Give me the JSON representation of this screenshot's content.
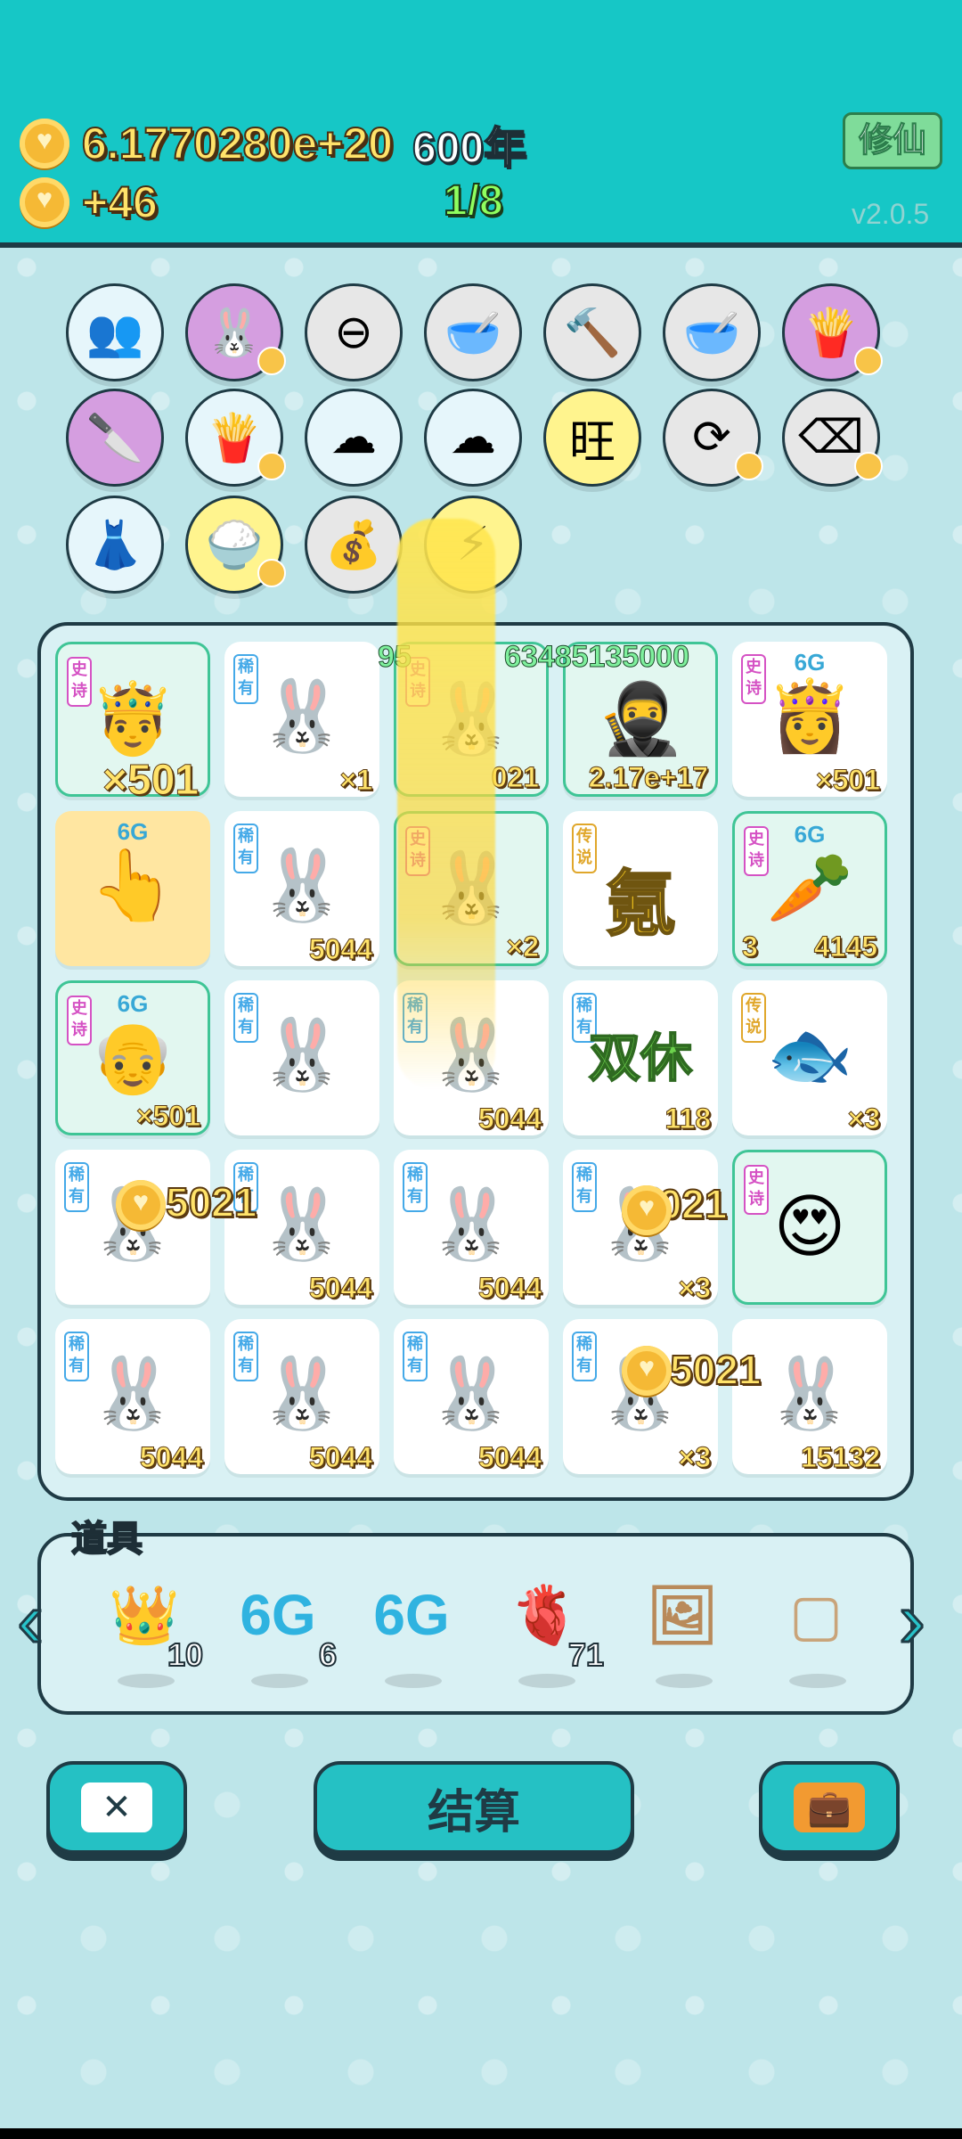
{
  "header": {
    "coins_total": "6.1770280e+20",
    "years": "600年",
    "coins_rate": "+46",
    "level": "1/8",
    "cultivate_label": "修仙",
    "version": "v2.0.5"
  },
  "shelf": {
    "items": [
      {
        "name": "twins-icon",
        "glyph": "👥",
        "bg": "#e6f6fb"
      },
      {
        "name": "rabbit-icon",
        "glyph": "🐰",
        "bg": "#d59ee0"
      },
      {
        "name": "ban-icon",
        "glyph": "⊖",
        "bg": "#e7e7e7"
      },
      {
        "name": "dog-bowl-icon",
        "glyph": "🥣",
        "bg": "#e7e7e7"
      },
      {
        "name": "hammer-icon",
        "glyph": "🔨",
        "bg": "#e7e7e7"
      },
      {
        "name": "dog-bowl-icon",
        "glyph": "🥣",
        "bg": "#e7e7e7"
      },
      {
        "name": "fries-icon",
        "glyph": "🍟",
        "bg": "#d59ee0"
      },
      {
        "name": "cleaver-icon",
        "glyph": "🔪",
        "bg": "#d59ee0"
      },
      {
        "name": "fries-icon",
        "glyph": "🍟",
        "bg": "#e6f6fb"
      },
      {
        "name": "cloud-icon",
        "glyph": "☁",
        "bg": "#e6f6fb"
      },
      {
        "name": "cloud-icon",
        "glyph": "☁",
        "bg": "#e6f6fb"
      },
      {
        "name": "wang-icon",
        "glyph": "旺",
        "bg": "#fff48e"
      },
      {
        "name": "refresh-icon",
        "glyph": "⟳",
        "bg": "#e7e7e7"
      },
      {
        "name": "delete-icon",
        "glyph": "⌫",
        "bg": "#e7e7e7"
      },
      {
        "name": "skirt-icon",
        "glyph": "👗",
        "bg": "#e6f6fb"
      },
      {
        "name": "rice-bowl-icon",
        "glyph": "🍚",
        "bg": "#fff48e"
      },
      {
        "name": "bag-icon",
        "glyph": "💰",
        "bg": "#e7e7e7"
      },
      {
        "name": "lightning-icon",
        "glyph": "⚡",
        "bg": "#fff48e"
      }
    ]
  },
  "board": {
    "cells": [
      {
        "rank": "史诗",
        "tier": "epic",
        "glyph": "🤴",
        "count": "×501",
        "big": true,
        "card": "epic"
      },
      {
        "rank": "稀有",
        "tier": "rare",
        "glyph": "🐰",
        "count": "×1",
        "card": "plain"
      },
      {
        "rank": "史诗",
        "tier": "epic",
        "glyph": "🐰",
        "count": "021",
        "card": "epic"
      },
      {
        "rank": "",
        "tier": "",
        "glyph": "🥷",
        "count": "2.17e+17",
        "card": "epic"
      },
      {
        "rank": "史诗",
        "tier": "epic",
        "glyph": "👸",
        "top": "6G",
        "count": "×501",
        "card": "plain"
      },
      {
        "rank": "",
        "tier": "",
        "glyph": "👆",
        "top": "6G",
        "count": "",
        "card": "gold"
      },
      {
        "rank": "稀有",
        "tier": "rare",
        "glyph": "🐰",
        "count": "5044",
        "card": "plain"
      },
      {
        "rank": "史诗",
        "tier": "epic",
        "glyph": "🐰",
        "count": "×2",
        "card": "epic"
      },
      {
        "rank": "传说",
        "tier": "leg",
        "char": "氪",
        "count": "",
        "card": "plain"
      },
      {
        "rank": "史诗",
        "tier": "epic",
        "glyph": "🥕",
        "top": "6G",
        "count": "4145",
        "card": "epic",
        "left_num": "3"
      },
      {
        "rank": "史诗",
        "tier": "epic",
        "glyph": "👴",
        "top": "6G",
        "count": "×501",
        "card": "epic"
      },
      {
        "rank": "稀有",
        "tier": "rare",
        "glyph": "🐰",
        "count": "",
        "card": "plain"
      },
      {
        "rank": "稀有",
        "tier": "rare",
        "glyph": "🐰",
        "count": "5044",
        "card": "plain"
      },
      {
        "rank": "稀有",
        "tier": "rare",
        "shuangxiu": "双休",
        "count": "118",
        "card": "plain"
      },
      {
        "rank": "传说",
        "tier": "leg",
        "glyph": "🐟",
        "count": "×3",
        "card": "plain"
      },
      {
        "rank": "稀有",
        "tier": "rare",
        "glyph": "🐰",
        "count": "",
        "card": "plain"
      },
      {
        "rank": "稀有",
        "tier": "rare",
        "glyph": "🐰",
        "count": "5044",
        "card": "plain"
      },
      {
        "rank": "稀有",
        "tier": "rare",
        "glyph": "🐰",
        "count": "5044",
        "card": "plain"
      },
      {
        "rank": "稀有",
        "tier": "rare",
        "glyph": "🐰",
        "count": "×3",
        "card": "plain"
      },
      {
        "rank": "史诗",
        "tier": "epic",
        "glyph": "😍",
        "count": "",
        "card": "epic"
      },
      {
        "rank": "稀有",
        "tier": "rare",
        "glyph": "🐰",
        "count": "5044",
        "card": "plain"
      },
      {
        "rank": "稀有",
        "tier": "rare",
        "glyph": "🐰",
        "count": "5044",
        "card": "plain"
      },
      {
        "rank": "稀有",
        "tier": "rare",
        "glyph": "🐰",
        "count": "5044",
        "card": "plain"
      },
      {
        "rank": "稀有",
        "tier": "rare",
        "glyph": "🐰",
        "count": "×3",
        "card": "plain"
      },
      {
        "rank": "",
        "tier": "",
        "glyph": "🐰",
        "count": "15132",
        "card": "plain"
      }
    ],
    "floating": {
      "top_value": "63485135000",
      "top_value_left": "95",
      "coin_pop_1": "5021",
      "coin_pop_2": "5021",
      "coin_pop_3": "5021"
    }
  },
  "props": {
    "title": "道具",
    "items": [
      {
        "name": "crown-icon",
        "glyph": "👑",
        "count": "10"
      },
      {
        "name": "6g-icon",
        "glyph": "6G",
        "count": "6"
      },
      {
        "name": "6g-icon",
        "glyph": "6G",
        "count": ""
      },
      {
        "name": "liver-icon",
        "glyph": "🫀",
        "count": "71"
      },
      {
        "name": "portrait-icon",
        "glyph": "🖼",
        "count": ""
      },
      {
        "name": "blank-frame-icon",
        "glyph": "▢",
        "count": ""
      }
    ]
  },
  "buttons": {
    "settle_label": "结算"
  },
  "colors": {
    "header": "#16c7c6",
    "accent": "#25c1c4",
    "outline": "#1f3b45",
    "coin": "#f5b935"
  }
}
